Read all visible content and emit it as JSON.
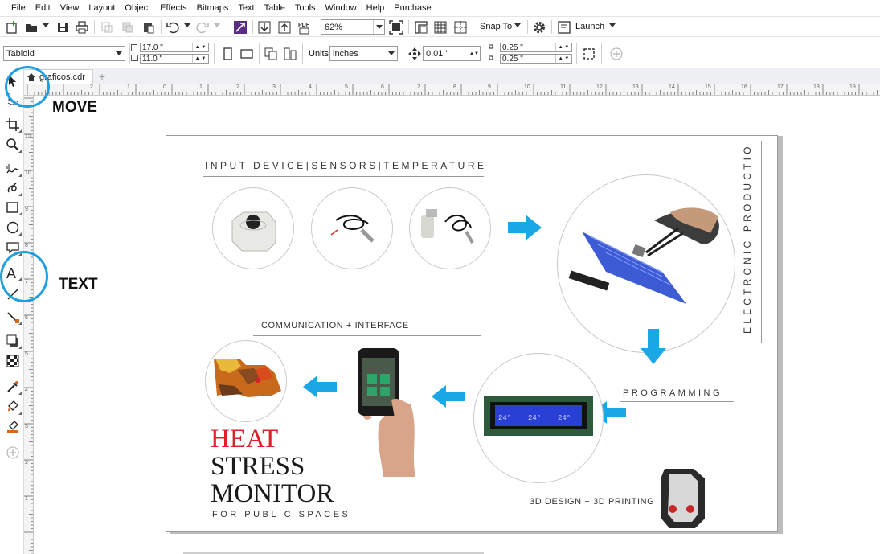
{
  "menu": [
    "File",
    "Edit",
    "View",
    "Layout",
    "Object",
    "Effects",
    "Bitmaps",
    "Text",
    "Table",
    "Tools",
    "Window",
    "Help",
    "Purchase"
  ],
  "toolbar": {
    "zoom": "62%",
    "snap_to": "Snap To",
    "launch": "Launch"
  },
  "property_bar": {
    "page_size": "Tabloid",
    "width": "17.0 \"",
    "height": "11.0 \"",
    "units_label": "Units:",
    "units": "inches",
    "nudge": "0.01 \"",
    "dup_x": "0.25 \"",
    "dup_y": "0.25 \""
  },
  "document_tab": "graficos.cdr",
  "rulers": {
    "horizontal": [
      "2",
      "1",
      "0",
      "1",
      "2",
      "3",
      "4",
      "5",
      "6",
      "7",
      "8",
      "9",
      "10",
      "11",
      "12",
      "13",
      "14",
      "15",
      "16",
      "17",
      "18",
      "19"
    ],
    "vertical": [
      "12",
      "11",
      "10",
      "9",
      "8",
      "7",
      "6",
      "5",
      "4",
      "3",
      "2",
      "1"
    ]
  },
  "poster": {
    "input_title": "INPUT DEVICE|SENSORS|TEMPERATURE",
    "vertical_title": "ELECTRONIC PRODUCTION",
    "communication": "COMMUNICATION + INTERFACE",
    "programming": "PROGRAMMING",
    "design": "3D DESIGN + 3D PRINTING",
    "lcd_values": [
      "24°",
      "24°",
      "24°"
    ],
    "heading_red": "HEAT",
    "heading_2": "STRESS",
    "heading_3": "MONITOR",
    "subheading": "FOR PUBLIC SPACES"
  },
  "annotations": {
    "move": "MOVE",
    "text": "TEXT"
  },
  "colors": {
    "annotation": "#1f9fe0",
    "arrow": "#1ba6e6",
    "heat_red": "#d8232a",
    "lcd_blue": "#2a3fd6"
  },
  "icons": [
    "new-document-icon",
    "open-icon",
    "save-icon",
    "print-icon",
    "cut-icon",
    "copy-icon",
    "paste-icon",
    "undo-icon",
    "redo-icon",
    "corel-connect-icon",
    "import-icon",
    "export-icon",
    "publish-pdf-icon",
    "full-screen-icon",
    "rulers-icon",
    "grid-icon",
    "guidelines-icon",
    "options-gear-icon",
    "launch-icon",
    "pick-tool-icon",
    "freehand-pick-icon",
    "crop-tool-icon",
    "zoom-tool-icon",
    "freehand-tool-icon",
    "artistic-media-icon",
    "rectangle-tool-icon",
    "ellipse-tool-icon",
    "callout-tool-icon",
    "text-tool-icon",
    "parallel-dimension-icon",
    "connector-tool-icon",
    "drop-shadow-icon",
    "transparency-icon",
    "eyedropper-icon",
    "interactive-fill-icon",
    "smart-fill-icon",
    "add-tool-icon"
  ]
}
